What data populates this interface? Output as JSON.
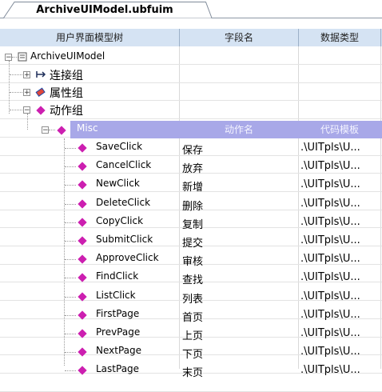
{
  "tab": {
    "title": "ArchiveUIModel.ubfuim"
  },
  "columns": [
    "用户界面模型树",
    "字段名",
    "数据类型"
  ],
  "tree": {
    "root": "ArchiveUIModel",
    "groups": [
      "连接组",
      "属性组",
      "动作组"
    ],
    "misc": {
      "label": "Misc",
      "col2": "动作名",
      "col3": "代码模板"
    },
    "actions": [
      {
        "name": "SaveClick",
        "label": "保存",
        "template": ".\\UITpls\\U..."
      },
      {
        "name": "CancelClick",
        "label": "放弃",
        "template": ".\\UITpls\\U..."
      },
      {
        "name": "NewClick",
        "label": "新增",
        "template": ".\\UITpls\\U..."
      },
      {
        "name": "DeleteClick",
        "label": "删除",
        "template": ".\\UITpls\\U..."
      },
      {
        "name": "CopyClick",
        "label": "复制",
        "template": ".\\UITpls\\U..."
      },
      {
        "name": "SubmitClick",
        "label": "提交",
        "template": ".\\UITpls\\U..."
      },
      {
        "name": "ApproveClick",
        "label": "审核",
        "template": ".\\UITpls\\U..."
      },
      {
        "name": "FindClick",
        "label": "查找",
        "template": ".\\UITpls\\U..."
      },
      {
        "name": "ListClick",
        "label": "列表",
        "template": ".\\UITpls\\U..."
      },
      {
        "name": "FirstPage",
        "label": "首页",
        "template": ".\\UITpls\\U..."
      },
      {
        "name": "PrevPage",
        "label": "上页",
        "template": ".\\UITpls\\U..."
      },
      {
        "name": "NextPage",
        "label": "下页",
        "template": ".\\UITpls\\U..."
      },
      {
        "name": "LastPage",
        "label": "末页",
        "template": ".\\UITpls\\U..."
      }
    ]
  },
  "icons": {
    "root": "ui-model-icon",
    "connect": "connector-icon",
    "property": "property-group-icon",
    "action": "action-diamond-icon"
  },
  "colors": {
    "header_bg": "#d5e3f3",
    "misc_band": "#a8a8e8",
    "diamond": "#cc1fb0",
    "property_icon": "#e0473a"
  }
}
